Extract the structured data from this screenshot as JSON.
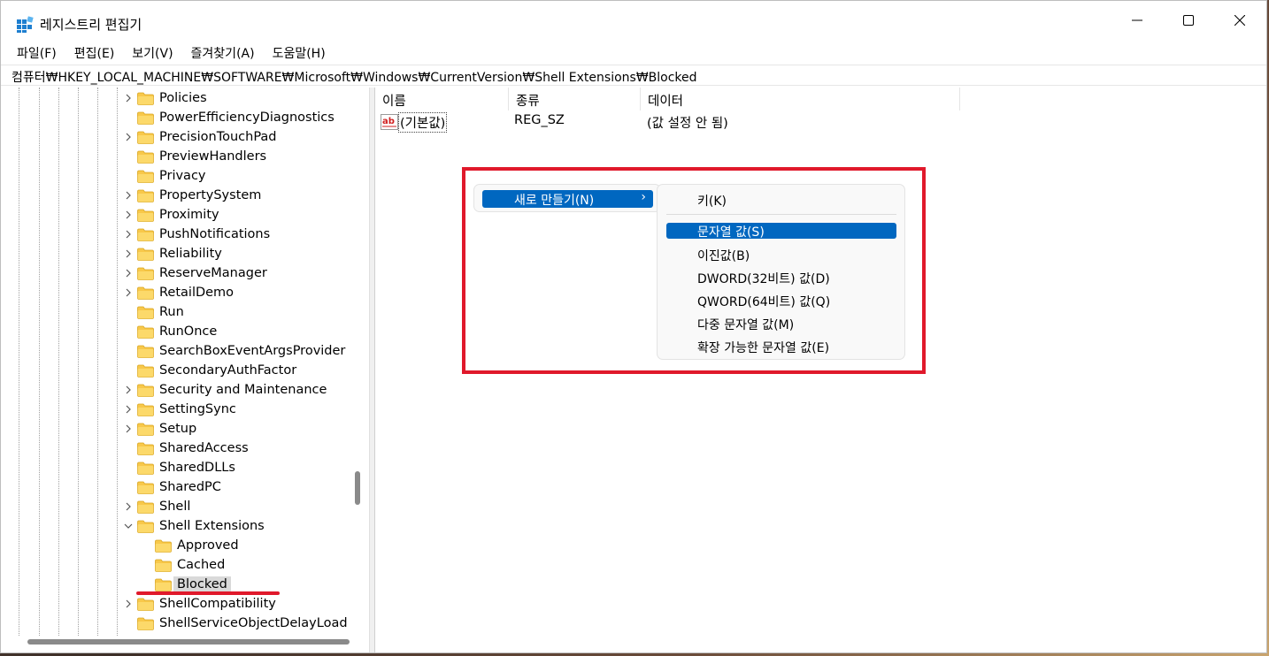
{
  "window": {
    "title": "레지스트리 편집기",
    "controls": {
      "minimize": "minimize",
      "maximize": "maximize",
      "close": "close"
    }
  },
  "menubar": [
    "파일(F)",
    "편집(E)",
    "보기(V)",
    "즐겨찾기(A)",
    "도움말(H)"
  ],
  "address": "컴퓨터₩HKEY_LOCAL_MACHINE₩SOFTWARE₩Microsoft₩Windows₩CurrentVersion₩Shell Extensions₩Blocked",
  "tree": {
    "items": [
      {
        "label": "Policies",
        "expander": "collapsed"
      },
      {
        "label": "PowerEfficiencyDiagnostics",
        "expander": "none"
      },
      {
        "label": "PrecisionTouchPad",
        "expander": "collapsed"
      },
      {
        "label": "PreviewHandlers",
        "expander": "none"
      },
      {
        "label": "Privacy",
        "expander": "none"
      },
      {
        "label": "PropertySystem",
        "expander": "collapsed"
      },
      {
        "label": "Proximity",
        "expander": "collapsed"
      },
      {
        "label": "PushNotifications",
        "expander": "collapsed"
      },
      {
        "label": "Reliability",
        "expander": "collapsed"
      },
      {
        "label": "ReserveManager",
        "expander": "collapsed"
      },
      {
        "label": "RetailDemo",
        "expander": "collapsed"
      },
      {
        "label": "Run",
        "expander": "none"
      },
      {
        "label": "RunOnce",
        "expander": "none"
      },
      {
        "label": "SearchBoxEventArgsProvider",
        "expander": "none"
      },
      {
        "label": "SecondaryAuthFactor",
        "expander": "none"
      },
      {
        "label": "Security and Maintenance",
        "expander": "collapsed"
      },
      {
        "label": "SettingSync",
        "expander": "collapsed"
      },
      {
        "label": "Setup",
        "expander": "collapsed"
      },
      {
        "label": "SharedAccess",
        "expander": "none"
      },
      {
        "label": "SharedDLLs",
        "expander": "none"
      },
      {
        "label": "SharedPC",
        "expander": "none"
      },
      {
        "label": "Shell",
        "expander": "collapsed"
      },
      {
        "label": "Shell Extensions",
        "expander": "expanded"
      },
      {
        "label": "Approved",
        "expander": "child"
      },
      {
        "label": "Cached",
        "expander": "child"
      },
      {
        "label": "Blocked",
        "expander": "child-selected"
      },
      {
        "label": "ShellCompatibility",
        "expander": "collapsed"
      },
      {
        "label": "ShellServiceObjectDelayLoad",
        "expander": "none"
      }
    ]
  },
  "list": {
    "columns": [
      "이름",
      "종류",
      "데이터"
    ],
    "rows": [
      {
        "name": "(기본값)",
        "type": "REG_SZ",
        "data": "(값 설정 안 됨)",
        "icon": "string-value-icon"
      }
    ]
  },
  "context_menu": {
    "new_label": "새로 만들기(N)",
    "new_arrow": "›",
    "submenu": [
      {
        "label": "키(K)"
      },
      {
        "label": "문자열 값(S)",
        "highlighted": true
      },
      {
        "label": "이진값(B)"
      },
      {
        "label": "DWORD(32비트) 값(D)"
      },
      {
        "label": "QWORD(64비트) 값(Q)"
      },
      {
        "label": "다중 문자열 값(M)"
      },
      {
        "label": "확장 가능한 문자열 값(E)"
      }
    ]
  },
  "colors": {
    "accent": "#0067c0",
    "annotation_red": "#e0192b",
    "folder_yellow": "#f8c84a"
  }
}
